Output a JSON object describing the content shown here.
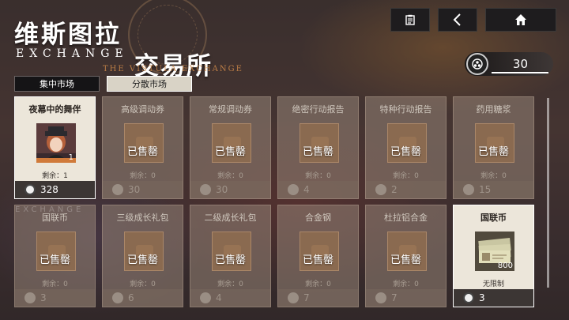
{
  "header": {
    "title_cn": "维斯图拉",
    "title_en": "EXCHANGE",
    "title_cn2": "交易所",
    "subtitle": "THE VISTULA EXCHANGE"
  },
  "top_buttons": [
    {
      "name": "clipboard-icon"
    },
    {
      "name": "back-arrow-icon"
    },
    {
      "name": "home-icon"
    }
  ],
  "currency": {
    "value": "30",
    "icon": "coin-icon"
  },
  "tabs": [
    {
      "label": "集中市场",
      "selected": false
    },
    {
      "label": "分散市场",
      "selected": true
    }
  ],
  "sold_label": "已售罄",
  "items": [
    {
      "name": "夜幕中的舞伴",
      "status": "active",
      "remain": "剩余：1",
      "price": "328",
      "count": "1"
    },
    {
      "name": "高级调动券",
      "status": "sold",
      "remain": "剩余：0",
      "price": "30"
    },
    {
      "name": "常规调动券",
      "status": "sold",
      "remain": "剩余：0",
      "price": "30"
    },
    {
      "name": "绝密行动报告",
      "status": "sold",
      "remain": "剩余：0",
      "price": "4"
    },
    {
      "name": "特种行动报告",
      "status": "sold",
      "remain": "剩余：0",
      "price": "2"
    },
    {
      "name": "药用糖浆",
      "status": "sold",
      "remain": "剩余：0",
      "price": "15"
    },
    {
      "name": "国联币",
      "status": "sold",
      "remain": "剩余：0",
      "price": "3"
    },
    {
      "name": "三级成长礼包",
      "status": "sold",
      "remain": "剩余：0",
      "price": "6"
    },
    {
      "name": "二级成长礼包",
      "status": "sold",
      "remain": "剩余：0",
      "price": "4"
    },
    {
      "name": "合金钢",
      "status": "sold",
      "remain": "剩余：0",
      "price": "7"
    },
    {
      "name": "杜拉铝合金",
      "status": "sold",
      "remain": "剩余：0",
      "price": "7"
    },
    {
      "name": "国联币",
      "status": "active",
      "remain": "无限制",
      "price": "3",
      "count": "800"
    }
  ],
  "watermark": "EXCHANGE"
}
